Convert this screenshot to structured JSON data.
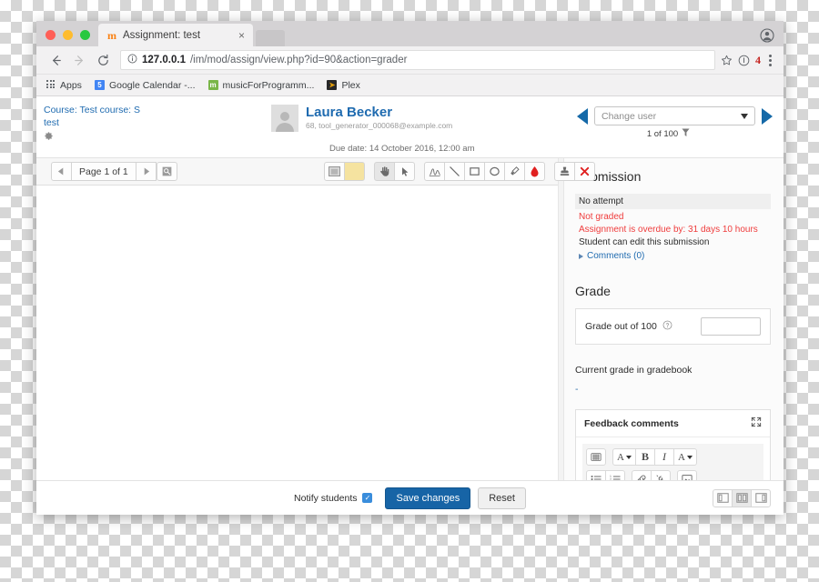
{
  "browser": {
    "tab": {
      "title": "Assignment: test",
      "favicon": "moodle-m-icon",
      "close": "×"
    },
    "url": {
      "host": "127.0.0.1",
      "path": "/im/mod/assign/view.php?id=90&action=grader"
    },
    "toolbar": {
      "back": "←",
      "forward": "→",
      "reload": "C",
      "star": "star-icon",
      "info": "info-icon",
      "badge": "4",
      "menu": "kebab-menu-icon",
      "profile": "profile-avatar-icon"
    },
    "bookmarks": [
      {
        "label": "Apps",
        "icon": "apps-grid-icon",
        "color": "#5f6368"
      },
      {
        "label": "Google Calendar -...",
        "icon": "calendar-icon",
        "color": "#4285f4"
      },
      {
        "label": "musicForProgramm...",
        "icon": "m-icon",
        "color": "#7ab648"
      },
      {
        "label": "Plex",
        "icon": "plex-icon",
        "color": "#282828"
      }
    ]
  },
  "header": {
    "course_line1": "Course: Test course: S",
    "course_line2": "test",
    "gear": "gear-icon",
    "user_name": "Laura Becker",
    "user_email": "68, tool_generator_000068@example.com",
    "due_date": "Due date: 14 October 2016, 12:00 am",
    "prev": "previous-user-arrow",
    "next": "next-user-arrow",
    "change_user_placeholder": "Change user",
    "counter": "1 of 100",
    "filter": "funnel-icon"
  },
  "pdf_toolbar": {
    "prev_page": "previous-page-arrow",
    "page_label": "Page 1 of 1",
    "next_page": "next-page-arrow",
    "search": "search-comments-icon",
    "tools": [
      {
        "name": "current-colour-swatch",
        "icon": "grey-square"
      },
      {
        "name": "highlight-colour-swatch",
        "icon": "yellow-square"
      },
      {
        "name": "drag-tool",
        "icon": "hand-icon",
        "active": true
      },
      {
        "name": "select-tool",
        "icon": "cursor-arrow-icon",
        "active": false
      },
      {
        "name": "pen-tool",
        "icon": "signature-icon",
        "active": false
      },
      {
        "name": "line-tool",
        "icon": "line-icon",
        "active": false
      },
      {
        "name": "rectangle-tool",
        "icon": "rectangle-icon",
        "active": false
      },
      {
        "name": "ellipse-tool",
        "icon": "ellipse-icon",
        "active": false
      },
      {
        "name": "highlight-tool",
        "icon": "highlighter-icon",
        "active": false
      },
      {
        "name": "colour-picker",
        "icon": "red-drop-icon",
        "active": false
      },
      {
        "name": "stamp-tool",
        "icon": "stamp-icon",
        "active": false
      },
      {
        "name": "delete-annotation",
        "icon": "red-x-icon",
        "active": false
      }
    ]
  },
  "submission": {
    "title": "Submission",
    "status": "No attempt",
    "grading_status": "Not graded",
    "overdue": "Assignment is overdue by: 31 days 10 hours",
    "editable": "Student can edit this submission",
    "comments": "Comments (0)"
  },
  "grade": {
    "title": "Grade",
    "label": "Grade out of 100",
    "help": "help-icon",
    "value": "",
    "current_label": "Current grade in gradebook",
    "current_value": "-"
  },
  "feedback": {
    "title": "Feedback comments",
    "expand": "expand-icon",
    "toolbar_row1": [
      {
        "name": "accessibility-checker-button",
        "glyph": "⌸"
      },
      {
        "name": "font-colour-button",
        "glyph": "A",
        "caret": true
      },
      {
        "name": "bold-button",
        "glyph": "B"
      },
      {
        "name": "italic-button",
        "glyph": "I"
      },
      {
        "name": "background-colour-button",
        "glyph": "A",
        "caret": true
      }
    ],
    "toolbar_row2": [
      {
        "name": "bullet-list-button",
        "glyph": "☰"
      },
      {
        "name": "numbered-list-button",
        "glyph": "☰"
      },
      {
        "name": "insert-link-button",
        "glyph": "🔗"
      },
      {
        "name": "unlink-button",
        "glyph": "🔗"
      },
      {
        "name": "insert-image-button",
        "glyph": "⛰"
      }
    ]
  },
  "actions": {
    "notify_label": "Notify students",
    "notify_checked": true,
    "save_label": "Save changes",
    "reset_label": "Reset",
    "layouts": [
      {
        "name": "layout-collapse-right",
        "active": false
      },
      {
        "name": "layout-split-even",
        "active": true
      },
      {
        "name": "layout-collapse-left",
        "active": false
      }
    ]
  },
  "colors": {
    "link": "#1f6bb0",
    "danger": "#ef3c3c",
    "primary": "#1764a6",
    "accent_blue": "#1569a8",
    "highlight_yellow": "#f5e3a0"
  }
}
